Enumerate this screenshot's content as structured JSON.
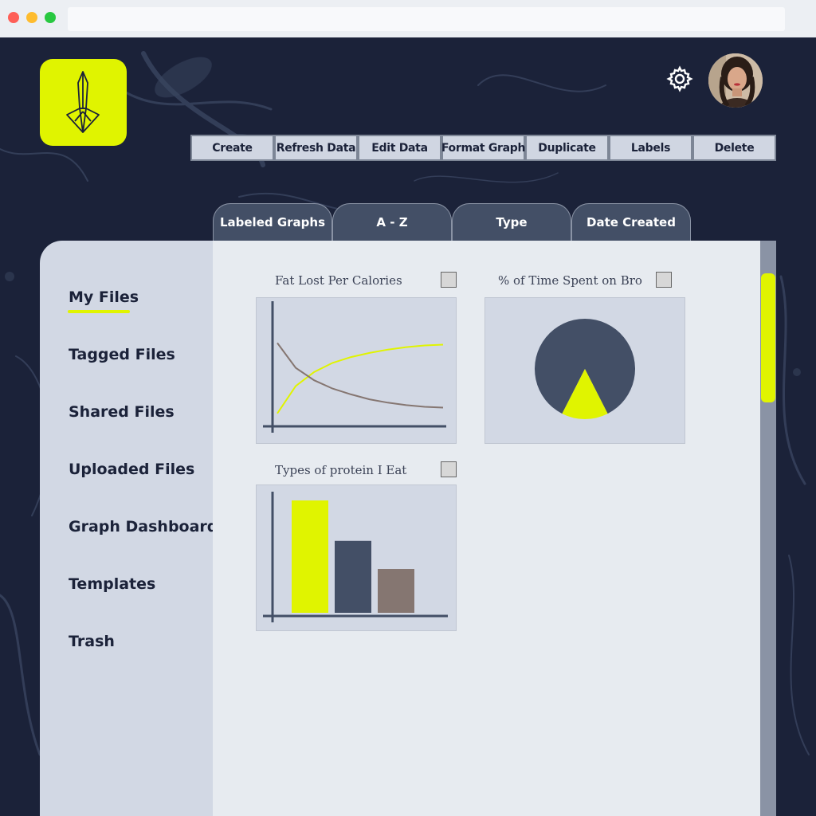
{
  "toolbar": {
    "buttons": [
      "Create",
      "Refresh Data",
      "Edit Data",
      "Format Graph",
      "Duplicate",
      "Labels",
      "Delete"
    ]
  },
  "tabs": [
    "Labeled Graphs",
    "A - Z",
    "Type",
    "Date Created"
  ],
  "sidebar": {
    "items": [
      "My Files",
      "Tagged Files",
      "Shared Files",
      "Uploaded Files",
      "Graph Dashboard",
      "Templates",
      "Trash"
    ],
    "active": "My Files"
  },
  "graphs": [
    {
      "title": "Fat Lost Per Calories",
      "type": "line",
      "checked": false
    },
    {
      "title": "% of Time Spent on Bro",
      "type": "pie",
      "checked": false
    },
    {
      "title": "Types of protein I Eat",
      "type": "bar",
      "checked": false
    }
  ],
  "colors": {
    "accent": "#e0f400",
    "dark": "#1b2239",
    "slate": "#434f66",
    "brown": "#857671",
    "panel": "#d2d8e4"
  },
  "icons": {
    "logo": "crystal-sword-icon",
    "settings": "gear-icon",
    "profile": "avatar"
  },
  "chart_data": [
    {
      "type": "line",
      "title": "Fat Lost Per Calories",
      "series": [
        {
          "values": [
            0.05,
            0.38,
            0.55,
            0.66,
            0.73,
            0.78,
            0.82,
            0.85,
            0.87,
            0.88
          ]
        },
        {
          "values": [
            0.9,
            0.6,
            0.45,
            0.35,
            0.28,
            0.22,
            0.18,
            0.15,
            0.13,
            0.12
          ]
        }
      ],
      "x": [
        1,
        2,
        3,
        4,
        5,
        6,
        7,
        8,
        9,
        10
      ]
    },
    {
      "type": "pie",
      "title": "% of Time Spent on Bro",
      "slices": [
        {
          "value": 85
        },
        {
          "value": 15
        }
      ]
    },
    {
      "type": "bar",
      "title": "Types of protein I Eat",
      "values": [
        100,
        64,
        39
      ]
    }
  ]
}
